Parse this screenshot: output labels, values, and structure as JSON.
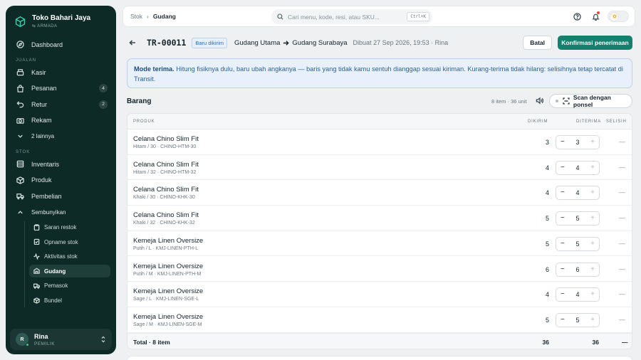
{
  "brand": {
    "name": "Toko Bahari Jaya",
    "sub": "ARMADA"
  },
  "nav": {
    "dashboard": "Dashboard",
    "section_jualan": "JUALAN",
    "kasir": "Kasir",
    "pesanan": "Pesanan",
    "pesanan_badge": "4",
    "retur": "Retur",
    "retur_badge": "2",
    "rekam": "Rekam",
    "more": "2 lainnya",
    "section_stok": "STOK",
    "inventaris": "Inventaris",
    "produk": "Produk",
    "pembelian": "Pembelian",
    "hide": "Sembunyikan",
    "sub_items": [
      {
        "label": "Saran restok",
        "icon": "clipboard-icon"
      },
      {
        "label": "Opname stok",
        "icon": "checklist-icon"
      },
      {
        "label": "Aktivitas stok",
        "icon": "activity-icon"
      },
      {
        "label": "Gudang",
        "icon": "warehouse-icon"
      },
      {
        "label": "Pemasok",
        "icon": "truck-icon"
      },
      {
        "label": "Bundel",
        "icon": "box-icon"
      }
    ]
  },
  "user": {
    "initial": "R",
    "name": "Rina",
    "role": "PEMILIK"
  },
  "topbar": {
    "crumb_parent": "Stok",
    "crumb_current": "Gudang",
    "search_placeholder": "Cari menu, kode, resi, atau SKU...",
    "shortcut": "Ctrl+K"
  },
  "header": {
    "code": "TR-00011",
    "status": "Baru dikirim",
    "from": "Gudang Utama",
    "to": "Gudang Surabaya",
    "meta": "Dibuat 27 Sep 2026, 19:53 · Rina",
    "cancel": "Batal",
    "confirm": "Konfirmasi penerimaan"
  },
  "banner": {
    "title": "Mode terima.",
    "text": "Hitung fisiknya dulu, baru ubah angkanya — baris yang tidak kamu sentuh dianggap sesuai kiriman. Kurang-terima tidak hilang: selisihnya tetap tercatat di Transit."
  },
  "section": {
    "title": "Barang",
    "count": "8 item · 36 unit",
    "scan": "Scan dengan ponsel"
  },
  "table": {
    "headers": {
      "product": "PRODUK",
      "sent": "DIKIRIM",
      "received": "DITERIMA",
      "diff": "SELISIH"
    },
    "rows": [
      {
        "name": "Celana Chino Slim Fit",
        "variant": "Hitam / 30 · CHINO-HTM-30",
        "sent": "3",
        "received": "3",
        "diff": "—"
      },
      {
        "name": "Celana Chino Slim Fit",
        "variant": "Hitam / 32 · CHINO-HTM-32",
        "sent": "4",
        "received": "4",
        "diff": "—"
      },
      {
        "name": "Celana Chino Slim Fit",
        "variant": "Khaki / 30 · CHINO-KHK-30",
        "sent": "4",
        "received": "4",
        "diff": "—"
      },
      {
        "name": "Celana Chino Slim Fit",
        "variant": "Khaki / 32 · CHINO-KHK-32",
        "sent": "5",
        "received": "5",
        "diff": "—"
      },
      {
        "name": "Kemeja Linen Oversize",
        "variant": "Putih / L · KMJ-LINEN-PTH-L",
        "sent": "5",
        "received": "5",
        "diff": "—"
      },
      {
        "name": "Kemeja Linen Oversize",
        "variant": "Putih / M · KMJ-LINEN-PTH-M",
        "sent": "6",
        "received": "6",
        "diff": "—"
      },
      {
        "name": "Kemeja Linen Oversize",
        "variant": "Sage / L · KMJ-LINEN-SGE-L",
        "sent": "4",
        "received": "4",
        "diff": "—"
      },
      {
        "name": "Kemeja Linen Oversize",
        "variant": "Sage / M · KMJ-LINEN-SGE-M",
        "sent": "5",
        "received": "5",
        "diff": "—"
      }
    ],
    "footer": {
      "label": "Total · 8 item",
      "sent": "36",
      "received": "36",
      "diff": "—"
    }
  },
  "colors": {
    "sidebar": "#0d2a27",
    "accent": "#14806d",
    "info": "#2a5f98"
  }
}
